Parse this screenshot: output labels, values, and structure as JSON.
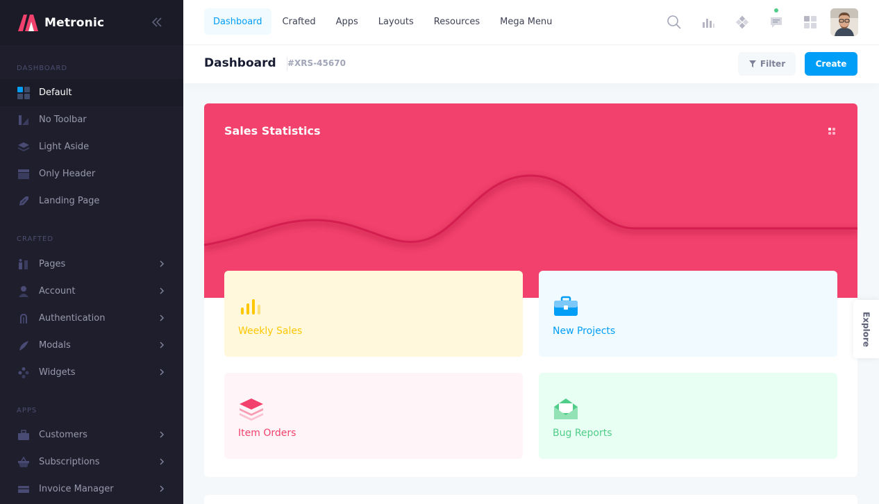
{
  "brand": {
    "name": "Metronic"
  },
  "sidebar": {
    "sections": [
      {
        "title": "DASHBOARD"
      },
      {
        "title": "CRAFTED"
      },
      {
        "title": "APPS"
      }
    ],
    "dashboard_items": [
      {
        "label": "Default",
        "icon": "grid-icon",
        "active": true
      },
      {
        "label": "No Toolbar",
        "icon": "toolbar-icon"
      },
      {
        "label": "Light Aside",
        "icon": "layers-icon"
      },
      {
        "label": "Only Header",
        "icon": "header-icon"
      },
      {
        "label": "Landing Page",
        "icon": "rocket-icon"
      }
    ],
    "crafted_items": [
      {
        "label": "Pages",
        "icon": "pages-icon"
      },
      {
        "label": "Account",
        "icon": "user-icon"
      },
      {
        "label": "Authentication",
        "icon": "fingerprint-icon"
      },
      {
        "label": "Modals",
        "icon": "modals-icon"
      },
      {
        "label": "Widgets",
        "icon": "widgets-icon"
      }
    ],
    "apps_items": [
      {
        "label": "Customers",
        "icon": "briefcase-icon"
      },
      {
        "label": "Subscriptions",
        "icon": "basket-icon"
      },
      {
        "label": "Invoice Manager",
        "icon": "invoice-icon"
      }
    ]
  },
  "header": {
    "nav": [
      {
        "label": "Dashboard",
        "active": true
      },
      {
        "label": "Crafted"
      },
      {
        "label": "Apps"
      },
      {
        "label": "Layouts"
      },
      {
        "label": "Resources"
      },
      {
        "label": "Mega Menu"
      }
    ]
  },
  "toolbar": {
    "title": "Dashboard",
    "code": "#XRS-45670",
    "filter_label": "Filter",
    "create_label": "Create"
  },
  "card": {
    "title": "Sales Statistics",
    "tiles": [
      {
        "label": "Weekly Sales",
        "icon": "bar-chart-icon"
      },
      {
        "label": "New Projects",
        "icon": "briefcase-icon"
      },
      {
        "label": "Item Orders",
        "icon": "layers-icon"
      },
      {
        "label": "Bug Reports",
        "icon": "envelope-icon"
      }
    ]
  },
  "explore": {
    "label": "Explore"
  },
  "colors": {
    "sidebar_bg": "#1e1e2d",
    "primary": "#009ef7",
    "danger": "#f1416c",
    "warning": "#ffc700",
    "success": "#50cd89"
  }
}
